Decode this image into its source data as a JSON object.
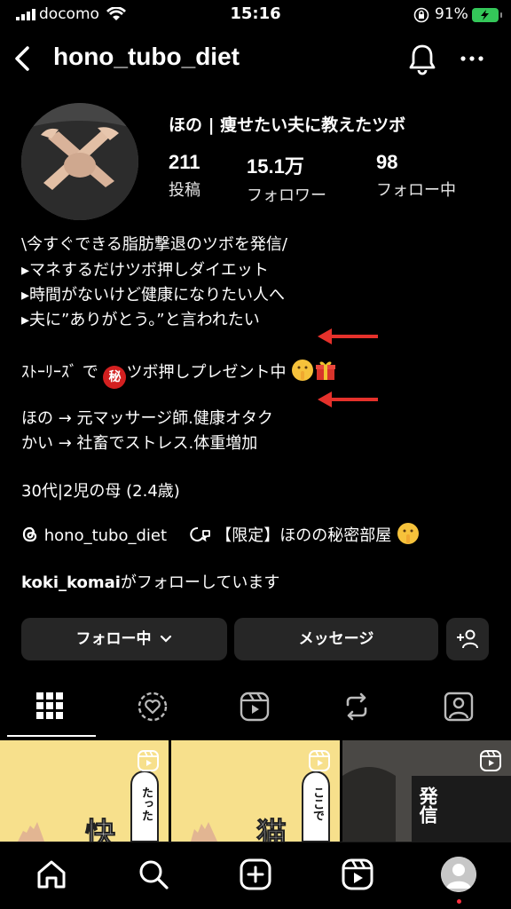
{
  "status_bar": {
    "carrier": "docomo",
    "time": "15:16",
    "battery": "91%"
  },
  "header": {
    "username": "hono_tubo_diet"
  },
  "profile": {
    "display_name": "ほの | 痩せたい夫に教えたツボ",
    "stats": [
      {
        "value": "211",
        "label": "投稿"
      },
      {
        "value": "15.1万",
        "label": "フォロワー"
      },
      {
        "value": "98",
        "label": "フォロー中"
      }
    ]
  },
  "bio": {
    "lines": [
      "\\今すぐできる脂肪撃退のツボを発信/",
      "▸マネするだけツボ押しダイエット",
      "▸時間がないけど健康になりたい人へ",
      "▸夫に”ありがとう。”と言われたい"
    ],
    "stories_prefix": "ｽﾄｰﾘｰｽﾞ で",
    "secret_mark": "秘",
    "stories_suffix": "ツボ押しプレゼント中",
    "roles": [
      "ほの → 元マッサージ師.健康オタク",
      "かい → 社畜でストレス.体重増加"
    ],
    "age": "30代|2児の母 (2.4歳)"
  },
  "links": {
    "threads_handle": "hono_tubo_diet",
    "channel_name": "【限定】ほのの秘密部屋"
  },
  "followed_by": {
    "name": "koki_komai",
    "suffix": "がフォローしています"
  },
  "buttons": {
    "following": "フォロー中",
    "message": "メッセージ"
  },
  "grid": {
    "cells": [
      {
        "big_char": "快",
        "bubble": "たった"
      },
      {
        "big_char": "猫",
        "bubble": "ここで"
      },
      {
        "big_char": "発信"
      }
    ]
  },
  "colors": {
    "accent_red": "#e5312b",
    "button_bg": "#262626",
    "cell_yellow": "#f7e08c"
  }
}
